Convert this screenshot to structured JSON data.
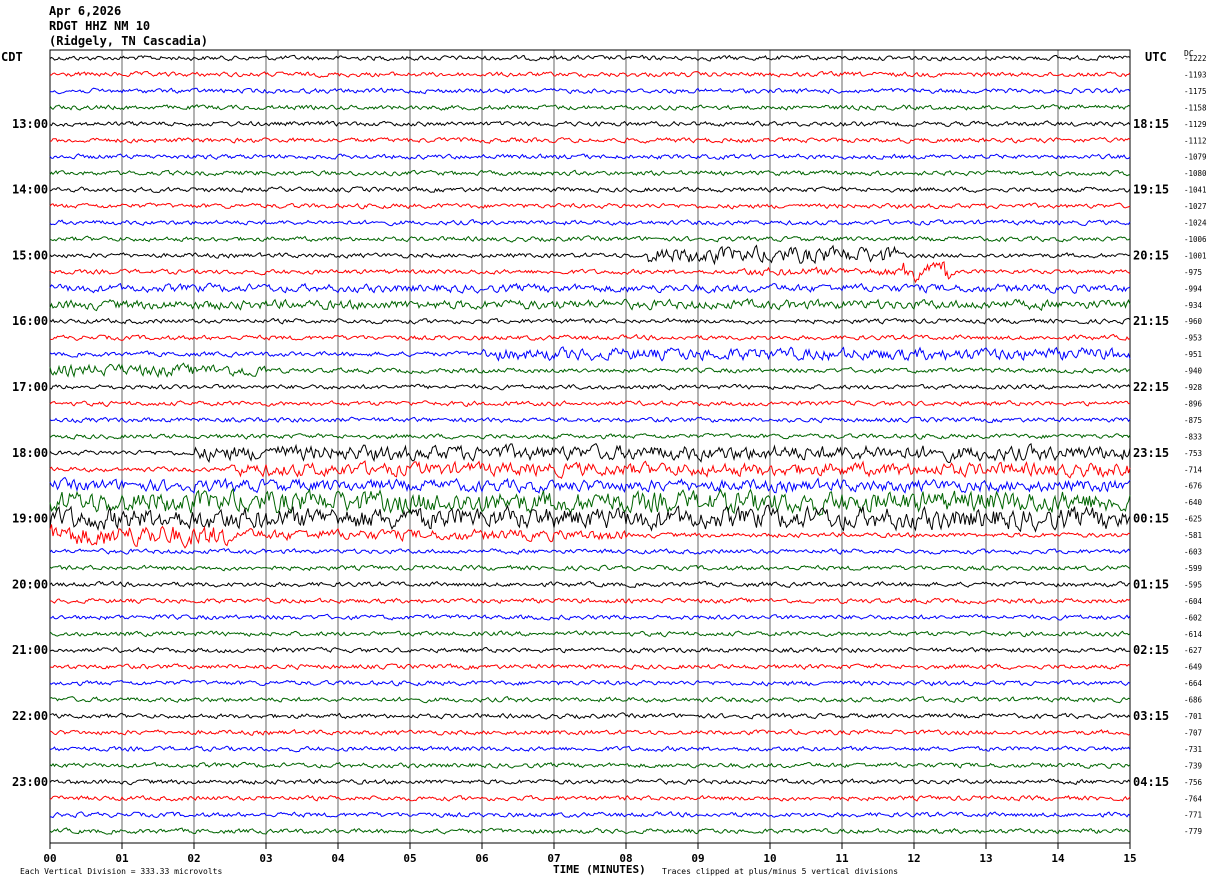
{
  "header": {
    "date": "Apr 6,2026",
    "station": "RDGT HHZ NM 10",
    "location": "(Ridgely, TN Cascadia)"
  },
  "labels": {
    "left_tz": "CDT",
    "right_tz": "UTC",
    "dc": "DC",
    "xlabel": "TIME (MINUTES)",
    "footer_left": "Each Vertical Division =  333.33 microvolts",
    "footer_right": "Traces clipped at plus/minus 5 vertical divisions"
  },
  "chart_data": {
    "type": "line",
    "title": "RDGT HHZ NM 10",
    "xlabel": "TIME (MINUTES)",
    "xlim": [
      0,
      15
    ],
    "x_ticks": [
      "00",
      "01",
      "02",
      "03",
      "04",
      "05",
      "06",
      "07",
      "08",
      "09",
      "10",
      "11",
      "12",
      "13",
      "14",
      "15"
    ],
    "trace_colors": [
      "#000000",
      "#ff0000",
      "#0000ff",
      "#006400"
    ],
    "trace_count": 48,
    "left_hour_labels": [
      "13:00",
      "14:00",
      "15:00",
      "16:00",
      "17:00",
      "18:00",
      "19:00",
      "20:00",
      "21:00",
      "22:00",
      "23:00"
    ],
    "right_hour_labels": [
      "18:15",
      "19:15",
      "20:15",
      "21:15",
      "22:15",
      "23:15",
      "00:15",
      "01:15",
      "02:15",
      "03:15",
      "04:15"
    ],
    "hour_label_first_trace": 4,
    "hour_label_every": 4,
    "dc_offsets": [
      "-1222",
      "-1193",
      "-1175",
      "-1158",
      "-1129",
      "-1112",
      "-1079",
      "-1080",
      "-1041",
      "-1027",
      "-1024",
      "-1006",
      "-1001",
      "-975",
      "-994",
      "-934",
      "-960",
      "-953",
      "-951",
      "-940",
      "-928",
      "-896",
      "-875",
      "-833",
      "-753",
      "-714",
      "-676",
      "-640",
      "-625",
      "-581",
      "-603",
      "-599",
      "-595",
      "-604",
      "-602",
      "-614",
      "-627",
      "-649",
      "-664",
      "-686",
      "-701",
      "-707",
      "-731",
      "-739",
      "-756",
      "-764",
      "-771",
      "-779"
    ],
    "noise_amplitude": 3.5,
    "events": [
      {
        "trace": 12,
        "start_min": 8.3,
        "end_min": 11.8,
        "amp": 12
      },
      {
        "trace": 13,
        "start_min": 11.8,
        "end_min": 12.5,
        "amp": 16
      },
      {
        "trace": 13,
        "start_min": 9.5,
        "end_min": 12.0,
        "amp": 6
      },
      {
        "trace": 14,
        "start_min": 0.0,
        "end_min": 15.0,
        "amp": 6
      },
      {
        "trace": 15,
        "start_min": 0.0,
        "end_min": 15.0,
        "amp": 7
      },
      {
        "trace": 18,
        "start_min": 6.0,
        "end_min": 15.0,
        "amp": 9
      },
      {
        "trace": 19,
        "start_min": 0.0,
        "end_min": 3.0,
        "amp": 9
      },
      {
        "trace": 24,
        "start_min": 2.0,
        "end_min": 15.0,
        "amp": 11
      },
      {
        "trace": 25,
        "start_min": 2.5,
        "end_min": 15.0,
        "amp": 10
      },
      {
        "trace": 26,
        "start_min": 0.0,
        "end_min": 15.0,
        "amp": 9
      },
      {
        "trace": 27,
        "start_min": 0.0,
        "end_min": 15.0,
        "amp": 16
      },
      {
        "trace": 28,
        "start_min": 0.0,
        "end_min": 15.0,
        "amp": 16
      },
      {
        "trace": 29,
        "start_min": 0.0,
        "end_min": 2.5,
        "amp": 16
      },
      {
        "trace": 29,
        "start_min": 2.5,
        "end_min": 8.0,
        "amp": 8
      }
    ]
  }
}
